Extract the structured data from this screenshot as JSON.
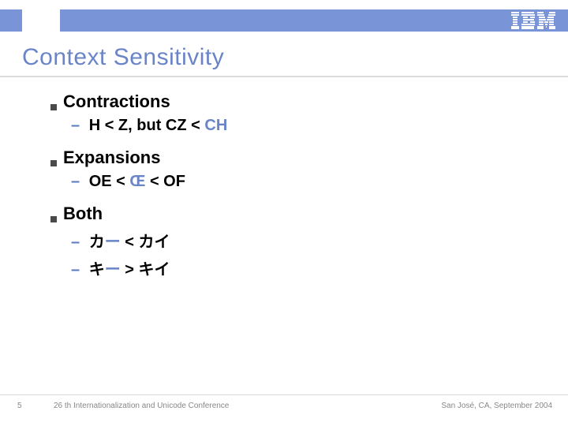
{
  "brand": {
    "name": "IBM"
  },
  "title": "Context Sensitivity",
  "sections": [
    {
      "heading": "Contractions",
      "items": [
        {
          "pre": "H < Z,",
          "mid": " but CZ < ",
          "post": "CH"
        }
      ]
    },
    {
      "heading": "Expansions",
      "items": [
        {
          "pre": "OE < ",
          "mid": "Œ",
          "post": " < OF"
        }
      ]
    },
    {
      "heading": "Both",
      "items": [
        {
          "pre": "カ",
          "mid": "ー",
          "post": " < カイ"
        },
        {
          "pre": "キ",
          "mid": "ー",
          "post": " > キイ"
        }
      ]
    }
  ],
  "footer": {
    "page": "5",
    "conference": "26 th Internationalization and Unicode Conference",
    "location": "San José, CA, September 2004"
  }
}
